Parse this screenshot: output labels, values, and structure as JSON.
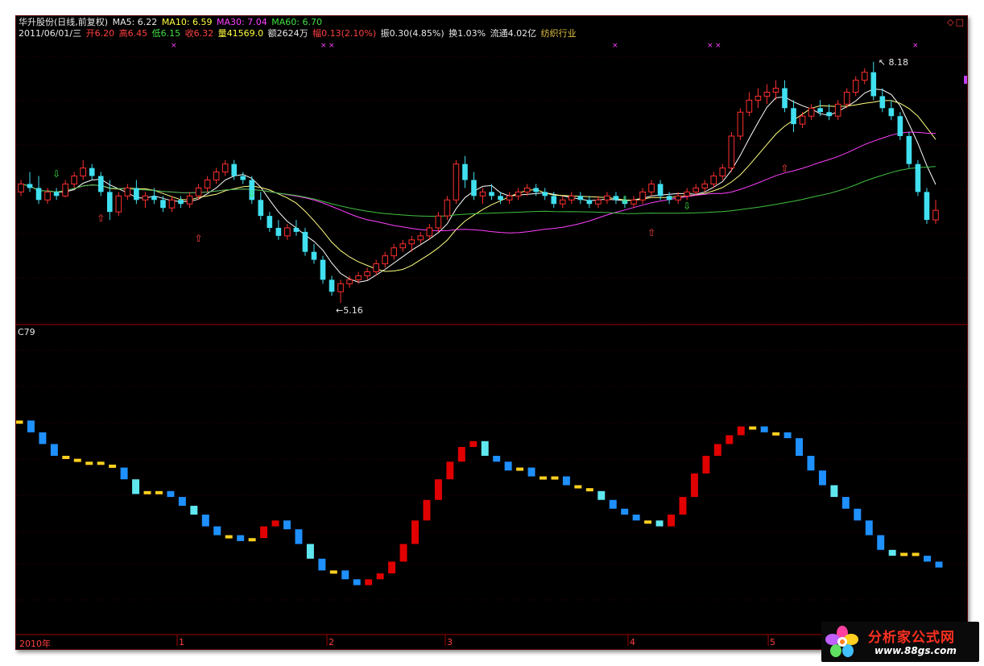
{
  "header": {
    "title": "华升股份(日线,前复权)",
    "ma5": "MA5: 6.22",
    "ma10": "MA10: 6.59",
    "ma30": "MA30: 7.04",
    "ma60": "MA60: 6.70",
    "date": "2011/06/01/三",
    "open": "开6.20",
    "high": "高6.45",
    "low": "低6.15",
    "close": "收6.32",
    "volume": "量41569.0",
    "amount": "额2624万",
    "change": "幅0.13(2.10%)",
    "amplitude": "振0.30(4.85%)",
    "turnover": "换1.03%",
    "float": "流通4.02亿",
    "industry": "纺织行业"
  },
  "annotations": {
    "high_label": "8.18",
    "low_label": "5.16"
  },
  "indicator": {
    "label": "C79"
  },
  "x_axis": {
    "labels": [
      "2010年",
      "1",
      "2",
      "3",
      "4",
      "5"
    ]
  },
  "window_controls": "◇□",
  "watermark": {
    "title": "分析家公式网",
    "url": "www.88gs.com"
  },
  "colors": {
    "background": "#000000",
    "rise": "#ff3030",
    "fall": "#40e0f0",
    "ma5": "#ffffff",
    "ma10": "#ffff80",
    "ma30": "#ff40ff",
    "ma60": "#40c040",
    "ind_red": "#e00000",
    "ind_blue": "#1e90ff",
    "ind_cyan": "#60e8f0",
    "ind_yellow": "#ffd020"
  },
  "chart_data": {
    "type": "candlestick",
    "price_range": [
      5.16,
      8.18
    ],
    "candles": [
      [
        6.55,
        6.7,
        6.5,
        6.65
      ],
      [
        6.65,
        6.8,
        6.55,
        6.6
      ],
      [
        6.6,
        6.75,
        6.4,
        6.45
      ],
      [
        6.45,
        6.6,
        6.4,
        6.55
      ],
      [
        6.55,
        6.6,
        6.45,
        6.5
      ],
      [
        6.5,
        6.7,
        6.48,
        6.65
      ],
      [
        6.65,
        6.8,
        6.6,
        6.75
      ],
      [
        6.75,
        6.95,
        6.7,
        6.85
      ],
      [
        6.85,
        6.9,
        6.7,
        6.75
      ],
      [
        6.75,
        6.8,
        6.5,
        6.55
      ],
      [
        6.55,
        6.7,
        6.2,
        6.3
      ],
      [
        6.3,
        6.55,
        6.25,
        6.5
      ],
      [
        6.5,
        6.65,
        6.45,
        6.6
      ],
      [
        6.6,
        6.7,
        6.4,
        6.45
      ],
      [
        6.45,
        6.55,
        6.35,
        6.5
      ],
      [
        6.5,
        6.6,
        6.4,
        6.45
      ],
      [
        6.45,
        6.5,
        6.3,
        6.35
      ],
      [
        6.35,
        6.5,
        6.3,
        6.45
      ],
      [
        6.45,
        6.5,
        6.35,
        6.4
      ],
      [
        6.4,
        6.55,
        6.35,
        6.5
      ],
      [
        6.5,
        6.65,
        6.45,
        6.6
      ],
      [
        6.6,
        6.75,
        6.55,
        6.7
      ],
      [
        6.7,
        6.85,
        6.65,
        6.8
      ],
      [
        6.8,
        6.95,
        6.75,
        6.9
      ],
      [
        6.9,
        6.95,
        6.7,
        6.75
      ],
      [
        6.75,
        6.8,
        6.65,
        6.7
      ],
      [
        6.7,
        6.75,
        6.4,
        6.45
      ],
      [
        6.45,
        6.55,
        6.2,
        6.25
      ],
      [
        6.25,
        6.3,
        6.05,
        6.1
      ],
      [
        6.1,
        6.2,
        5.95,
        6.0
      ],
      [
        6.0,
        6.15,
        5.95,
        6.1
      ],
      [
        6.1,
        6.2,
        6.0,
        6.05
      ],
      [
        6.05,
        6.1,
        5.75,
        5.8
      ],
      [
        5.8,
        5.9,
        5.65,
        5.7
      ],
      [
        5.7,
        5.75,
        5.4,
        5.45
      ],
      [
        5.45,
        5.5,
        5.25,
        5.3
      ],
      [
        5.3,
        5.45,
        5.16,
        5.4
      ],
      [
        5.4,
        5.5,
        5.35,
        5.45
      ],
      [
        5.45,
        5.55,
        5.4,
        5.5
      ],
      [
        5.5,
        5.6,
        5.45,
        5.55
      ],
      [
        5.55,
        5.7,
        5.5,
        5.65
      ],
      [
        5.65,
        5.8,
        5.6,
        5.75
      ],
      [
        5.75,
        5.9,
        5.7,
        5.85
      ],
      [
        5.85,
        5.95,
        5.8,
        5.9
      ],
      [
        5.9,
        6.0,
        5.8,
        5.95
      ],
      [
        5.95,
        6.05,
        5.9,
        6.0
      ],
      [
        6.0,
        6.15,
        5.95,
        6.1
      ],
      [
        6.1,
        6.3,
        6.05,
        6.25
      ],
      [
        6.25,
        6.5,
        6.2,
        6.45
      ],
      [
        6.45,
        6.95,
        6.4,
        6.9
      ],
      [
        6.9,
        7.0,
        6.6,
        6.7
      ],
      [
        6.7,
        6.8,
        6.45,
        6.5
      ],
      [
        6.5,
        6.6,
        6.4,
        6.55
      ],
      [
        6.55,
        6.65,
        6.45,
        6.5
      ],
      [
        6.5,
        6.55,
        6.4,
        6.45
      ],
      [
        6.45,
        6.55,
        6.4,
        6.5
      ],
      [
        6.5,
        6.6,
        6.45,
        6.55
      ],
      [
        6.55,
        6.65,
        6.5,
        6.6
      ],
      [
        6.6,
        6.65,
        6.5,
        6.55
      ],
      [
        6.55,
        6.6,
        6.45,
        6.5
      ],
      [
        6.5,
        6.55,
        6.35,
        6.4
      ],
      [
        6.4,
        6.5,
        6.35,
        6.45
      ],
      [
        6.45,
        6.55,
        6.4,
        6.5
      ],
      [
        6.5,
        6.55,
        6.4,
        6.45
      ],
      [
        6.45,
        6.5,
        6.35,
        6.4
      ],
      [
        6.4,
        6.5,
        6.35,
        6.45
      ],
      [
        6.45,
        6.55,
        6.4,
        6.5
      ],
      [
        6.5,
        6.55,
        6.4,
        6.45
      ],
      [
        6.45,
        6.5,
        6.35,
        6.4
      ],
      [
        6.4,
        6.5,
        6.35,
        6.45
      ],
      [
        6.45,
        6.6,
        6.4,
        6.55
      ],
      [
        6.55,
        6.7,
        6.5,
        6.65
      ],
      [
        6.65,
        6.7,
        6.45,
        6.5
      ],
      [
        6.5,
        6.55,
        6.4,
        6.45
      ],
      [
        6.45,
        6.55,
        6.4,
        6.5
      ],
      [
        6.5,
        6.6,
        6.45,
        6.55
      ],
      [
        6.55,
        6.65,
        6.5,
        6.6
      ],
      [
        6.6,
        6.7,
        6.55,
        6.65
      ],
      [
        6.65,
        6.8,
        6.6,
        6.75
      ],
      [
        6.75,
        6.9,
        6.7,
        6.85
      ],
      [
        6.85,
        7.3,
        6.8,
        7.25
      ],
      [
        7.25,
        7.6,
        7.2,
        7.55
      ],
      [
        7.55,
        7.8,
        7.5,
        7.7
      ],
      [
        7.7,
        7.85,
        7.6,
        7.75
      ],
      [
        7.75,
        7.9,
        7.65,
        7.8
      ],
      [
        7.8,
        7.95,
        7.7,
        7.85
      ],
      [
        7.85,
        7.95,
        7.55,
        7.6
      ],
      [
        7.6,
        7.7,
        7.3,
        7.4
      ],
      [
        7.4,
        7.55,
        7.35,
        7.5
      ],
      [
        7.5,
        7.65,
        7.45,
        7.6
      ],
      [
        7.6,
        7.7,
        7.5,
        7.55
      ],
      [
        7.55,
        7.65,
        7.45,
        7.5
      ],
      [
        7.5,
        7.7,
        7.45,
        7.65
      ],
      [
        7.65,
        7.85,
        7.6,
        7.8
      ],
      [
        7.8,
        8.0,
        7.75,
        7.95
      ],
      [
        7.95,
        8.1,
        7.9,
        8.05
      ],
      [
        8.05,
        8.18,
        7.7,
        7.75
      ],
      [
        7.75,
        7.85,
        7.55,
        7.6
      ],
      [
        7.6,
        7.7,
        7.45,
        7.5
      ],
      [
        7.5,
        7.55,
        7.2,
        7.25
      ],
      [
        7.25,
        7.3,
        6.85,
        6.9
      ],
      [
        6.9,
        6.95,
        6.5,
        6.55
      ],
      [
        6.55,
        6.6,
        6.15,
        6.2
      ],
      [
        6.2,
        6.45,
        6.15,
        6.32
      ]
    ],
    "indicator_series": {
      "name": "C79",
      "values": [
        72,
        68,
        64,
        60,
        59,
        58,
        58,
        57,
        56,
        52,
        47,
        48,
        48,
        46,
        43,
        40,
        36,
        33,
        33,
        31,
        32,
        36,
        38,
        35,
        30,
        25,
        21,
        21,
        18,
        16,
        18,
        20,
        24,
        30,
        38,
        45,
        52,
        58,
        63,
        65,
        60,
        58,
        55,
        56,
        53,
        52,
        53,
        50,
        49,
        48,
        45,
        42,
        40,
        38,
        38,
        36,
        40,
        46,
        54,
        60,
        64,
        67,
        70,
        70,
        68,
        68,
        66,
        60,
        55,
        50,
        46,
        42,
        38,
        33,
        28,
        26,
        27,
        26,
        24,
        22
      ]
    },
    "ylim": [
      5.16,
      8.18
    ]
  }
}
